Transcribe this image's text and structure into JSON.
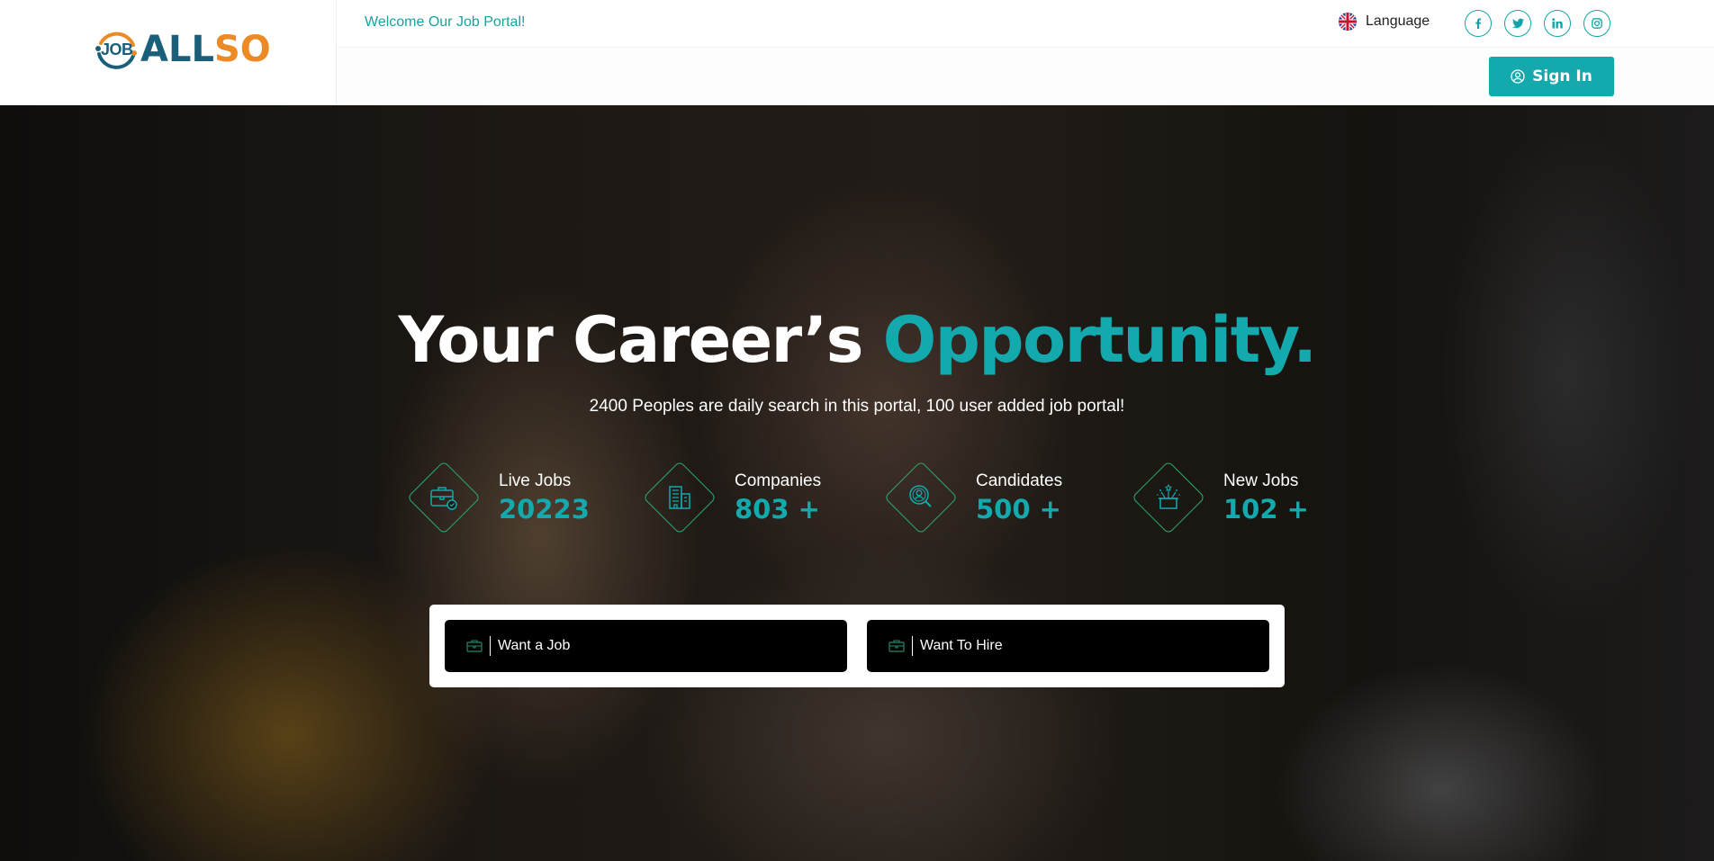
{
  "header": {
    "logo": {
      "prefix": "JOB",
      "part1": "ALL",
      "part2": "SO"
    },
    "welcome": "Welcome Our Job Portal!",
    "language_label": "Language",
    "socials": [
      {
        "name": "facebook",
        "glyph": "f"
      },
      {
        "name": "twitter",
        "glyph": "t"
      },
      {
        "name": "linkedin",
        "glyph": "in"
      },
      {
        "name": "instagram",
        "glyph": "ig"
      }
    ],
    "signin_label": "Sign In"
  },
  "hero": {
    "title_main": "Your Career’s",
    "title_accent": "Opportunity.",
    "subtitle": "2400 Peoples are daily search in this portal, 100 user added job portal!",
    "stats": [
      {
        "label": "Live Jobs",
        "value": "20223",
        "icon": "briefcase-check-icon"
      },
      {
        "label": "Companies",
        "value": "803 +",
        "icon": "building-icon"
      },
      {
        "label": "Candidates",
        "value": "500 +",
        "icon": "candidate-search-icon"
      },
      {
        "label": "New Jobs",
        "value": "102 +",
        "icon": "gift-box-icon"
      }
    ],
    "choices": [
      {
        "label": "Want a Job",
        "icon": "briefcase-icon"
      },
      {
        "label": "Want To Hire",
        "icon": "briefcase-icon"
      }
    ]
  },
  "colors": {
    "accent": "#13a9ad",
    "logo_blue": "#1a5f7a",
    "logo_orange": "#ec8a26",
    "icon_green": "#2aa76e"
  }
}
